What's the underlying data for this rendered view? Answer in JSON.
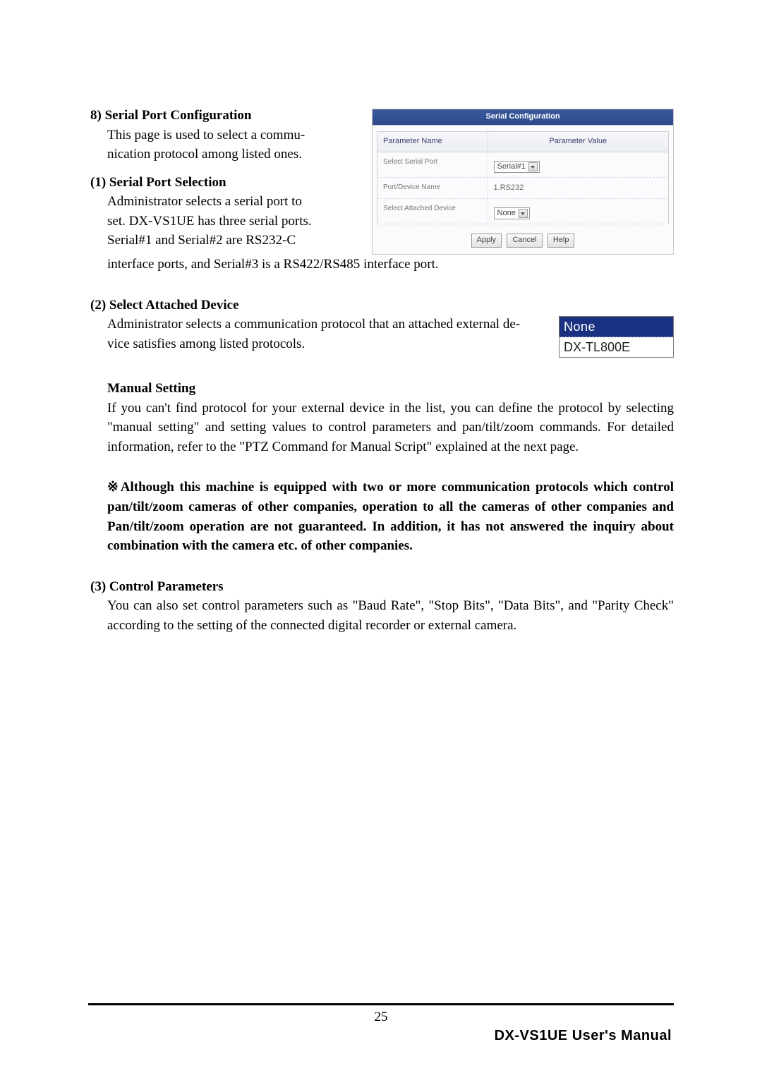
{
  "section8": {
    "title": "8) Serial Port Configuration",
    "intro_a": "This page is used to select a commu-",
    "intro_b": "nication protocol among listed ones."
  },
  "panel": {
    "title": "Serial Configuration",
    "header_name": "Parameter Name",
    "header_value": "Parameter Value",
    "rows": {
      "r0_label": "Select Serial Port",
      "r0_value": "Serial#1",
      "r1_label": "Port/Device Name",
      "r1_value": "1.RS232",
      "r2_label": "Select Attached Device",
      "r2_value": "None"
    },
    "buttons": {
      "apply": "Apply",
      "cancel": "Cancel",
      "help": "Help"
    }
  },
  "sub1": {
    "title": "(1) Serial Port Selection",
    "l1": "Administrator selects a serial port to",
    "l2": "set. DX-VS1UE has three serial ports.",
    "l3": "Serial#1 and Serial#2 are RS232-C",
    "rest": "interface ports, and Serial#3 is a RS422/RS485 interface port."
  },
  "sub2": {
    "title": "(2) Select Attached Device",
    "l1": "Administrator selects a communication protocol that an attached external de-",
    "l2": "vice satisfies among listed protocols."
  },
  "dropdown": {
    "selected": "None",
    "option": "DX-TL800E"
  },
  "manual": {
    "title": "Manual Setting",
    "body": "If you can't find protocol for your external device in the list, you can define the protocol by selecting \"manual setting\" and setting values to control parameters and pan/tilt/zoom commands. For detailed information, refer to the \"PTZ Command for Manual Script\" explained at the next page."
  },
  "note": {
    "body": "※Although this machine is equipped with two or more communication protocols which control pan/tilt/zoom cameras of other companies, operation to all the cameras of other companies and Pan/tilt/zoom operation are not guaranteed. In addition, it has not answered the inquiry about combination with the camera etc. of other companies."
  },
  "sub3": {
    "title": "(3) Control Parameters",
    "body": "You can also set control parameters such as \"Baud Rate\", \"Stop Bits\", \"Data Bits\", and \"Parity Check\" according to the setting of the connected digital recorder or external camera."
  },
  "footer": {
    "page": "25",
    "manual": "DX-VS1UE User's Manual"
  }
}
